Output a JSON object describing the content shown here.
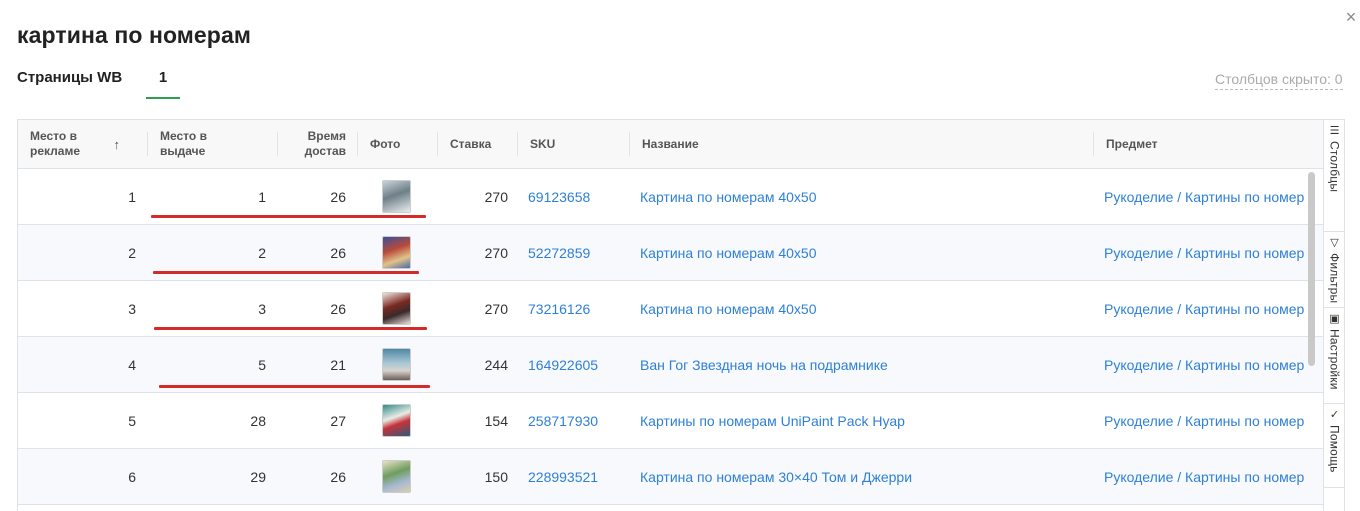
{
  "dialog": {
    "title": "картина по номерам",
    "close_icon": "×"
  },
  "tabs": {
    "label": "Страницы WB",
    "pages": [
      "1"
    ]
  },
  "hidden_columns": "Столбцов скрыто: 0",
  "colors": {
    "accent_green": "#2e9e4f",
    "link_blue": "#2f80d6",
    "highlight_red": "#d52a2a"
  },
  "grid": {
    "columns": [
      {
        "key": "ad_place",
        "label": "Место в рекламе",
        "sorted": "asc",
        "sort_icon": "↑"
      },
      {
        "key": "search_place",
        "label": "Место в выдаче"
      },
      {
        "key": "delivery_time",
        "label": "Время достав"
      },
      {
        "key": "photo",
        "label": "Фото"
      },
      {
        "key": "bid",
        "label": "Ставка"
      },
      {
        "key": "sku",
        "label": "SKU"
      },
      {
        "key": "name",
        "label": "Название"
      },
      {
        "key": "subject",
        "label": "Предмет"
      }
    ],
    "rows": [
      {
        "ad_place": "1",
        "search_place": "1",
        "delivery_time": "26",
        "photo": "product-thumbnail",
        "bid": "270",
        "sku": "69123658",
        "name": "Картина по номерам 40х50",
        "subject": "Рукоделие / Картины по номер",
        "underlined": true
      },
      {
        "ad_place": "2",
        "search_place": "2",
        "delivery_time": "26",
        "photo": "product-thumbnail",
        "bid": "270",
        "sku": "52272859",
        "name": "Картина по номерам 40х50",
        "subject": "Рукоделие / Картины по номер",
        "underlined": true
      },
      {
        "ad_place": "3",
        "search_place": "3",
        "delivery_time": "26",
        "photo": "product-thumbnail",
        "bid": "270",
        "sku": "73216126",
        "name": "Картина по номерам 40х50",
        "subject": "Рукоделие / Картины по номер",
        "underlined": true
      },
      {
        "ad_place": "4",
        "search_place": "5",
        "delivery_time": "21",
        "photo": "product-thumbnail",
        "bid": "244",
        "sku": "164922605",
        "name": "Ван Гог Звездная ночь на подрамнике",
        "subject": "Рукоделие / Картины по номер",
        "underlined": true
      },
      {
        "ad_place": "5",
        "search_place": "28",
        "delivery_time": "27",
        "photo": "product-thumbnail",
        "bid": "154",
        "sku": "258717930",
        "name": "Картины по номерам UniPaint Pack Нуар",
        "subject": "Рукоделие / Картины по номер",
        "underlined": false
      },
      {
        "ad_place": "6",
        "search_place": "29",
        "delivery_time": "26",
        "photo": "product-thumbnail",
        "bid": "150",
        "sku": "228993521",
        "name": "Картина по номерам 30×40 Том и Джерри",
        "subject": "Рукоделие / Картины по номер",
        "underlined": false
      }
    ]
  },
  "side_panel": [
    {
      "label": "Столбцы",
      "icon": "columns-icon",
      "glyph": "☰"
    },
    {
      "label": "Фильтры",
      "icon": "filter-icon",
      "glyph": "▽"
    },
    {
      "label": "Настройки",
      "icon": "settings-icon",
      "glyph": "▣"
    },
    {
      "label": "Помощь",
      "icon": "help-icon",
      "glyph": "✓"
    }
  ]
}
